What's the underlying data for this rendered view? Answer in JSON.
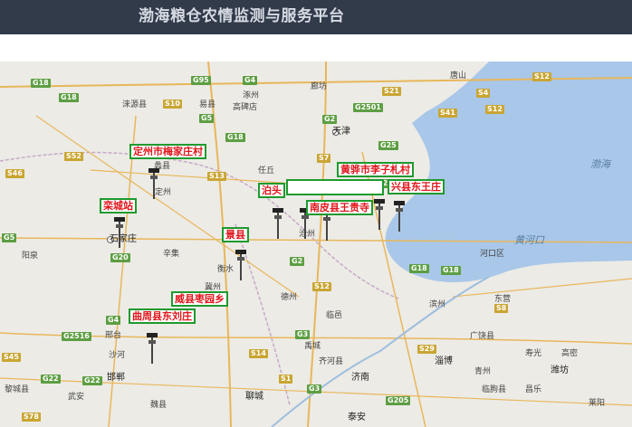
{
  "header": {
    "title": "渤海粮仓农情监测与服务平台"
  },
  "map": {
    "sea_label": "渤海",
    "river_label": "黄河口",
    "places": {
      "tangshan": "唐山",
      "langfang": "廊坊",
      "tianjin": "天津",
      "zhuozhou": "涿州",
      "gaobeidian": "高碑店",
      "laishui": "涞源县",
      "yixian": "易县",
      "renqiu": "任丘",
      "dingzhou": "定州",
      "anguo": "蠡县",
      "shijiazhuang": "石家庄",
      "yangquan": "阳泉",
      "xinji": "辛集",
      "hengshui": "衡水",
      "jizhou": "冀州",
      "dezhou": "德州",
      "cangzhou": "沧州",
      "binzhou": "滨州",
      "dongying": "东营",
      "hekou": "河口区",
      "xingtai": "邢台",
      "shahe": "沙河",
      "handan": "邯郸",
      "liaocheng": "聊城",
      "weixian": "魏县",
      "jinan": "济南",
      "zibo": "淄博",
      "weifang": "潍坊",
      "qingzhou": "青州",
      "linqu": "临朐县",
      "guangrao": "广饶县",
      "changle": "昌乐",
      "laiyang": "莱阳",
      "shouguang": "寿光",
      "gaomi": "高密",
      "taian": "泰安",
      "yucheng": "禹城",
      "qihe": "齐河县",
      "linyi": "临邑",
      "lixian": "黎城县",
      "wuhai": "武安"
    },
    "roads": {
      "g18a": "G18",
      "g18b": "G18",
      "g18c": "G18",
      "g18d": "G18",
      "g18e": "G18",
      "g95": "G95",
      "g4a": "G4",
      "g4b": "G4",
      "g5": "G5",
      "g5b": "G5",
      "s10": "S10",
      "s52": "S52",
      "s46": "S46",
      "s13": "S13",
      "s7": "S7",
      "g1": "G1",
      "g2a": "G2",
      "g2b": "G2",
      "g2501": "G2501",
      "s21": "S21",
      "s4": "S4",
      "s41": "S41",
      "s12a": "S12",
      "s12b": "S12",
      "s12c": "S12",
      "g25a": "G25",
      "g25b": "G25",
      "g20": "G20",
      "g3": "G3",
      "g3b": "G3",
      "g2516": "G2516",
      "s45": "S45",
      "g22a": "G22",
      "g22b": "G22",
      "s14": "S14",
      "s29": "S29",
      "g205": "G205",
      "s1": "S1",
      "s78": "S78",
      "s8": "S8"
    },
    "stations": [
      {
        "label": "定州市梅家庄村"
      },
      {
        "label": "栾城站"
      },
      {
        "label": "景县"
      },
      {
        "label": "泊头"
      },
      {
        "label": "黄骅市李子札村"
      },
      {
        "label": "兴县东王庄"
      },
      {
        "label": "南皮县王贵寺"
      },
      {
        "label": "威县枣园乡"
      },
      {
        "label": "曲周县东刘庄"
      }
    ]
  }
}
